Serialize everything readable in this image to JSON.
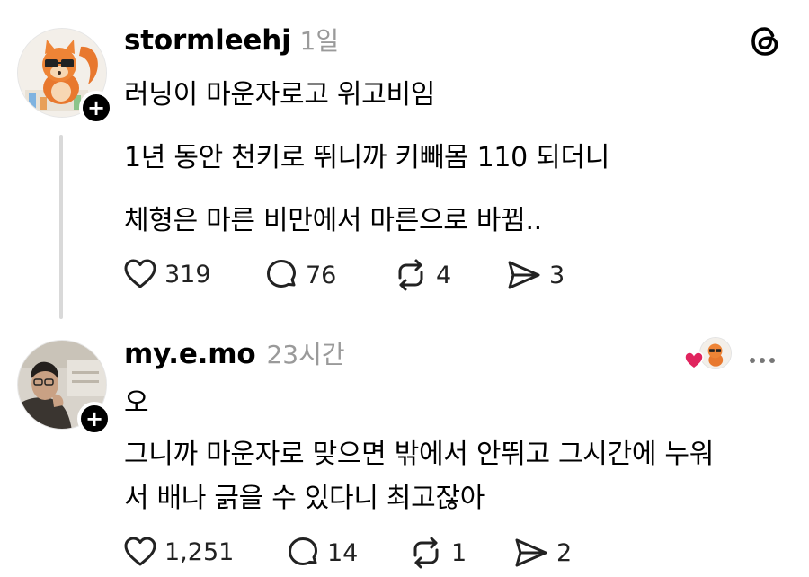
{
  "app": {
    "logo_icon": "threads-logo-icon"
  },
  "posts": [
    {
      "username": "stormleehj",
      "time": "1일",
      "lines": [
        "러닝이 마운자로고 위고비임",
        "1년 동안 천키로 뛰니까 키빼몸 110 되더니",
        "체형은 마른 비만에서 마른으로 바뀜.."
      ],
      "likes": "319",
      "comments": "76",
      "reposts": "4",
      "shares": "3"
    },
    {
      "username": "my.e.mo",
      "time": "23시간",
      "lines": [
        "오",
        "그니까 마운자로 맞으면 밖에서 안뛰고 그시간에 누워",
        "서 배나 긁을 수 있다니 최고잖아"
      ],
      "likes": "1,251",
      "comments": "14",
      "reposts": "1",
      "shares": "2"
    }
  ],
  "colors": {
    "heart_liked": "#e0245e",
    "muted": "#9a9a9a",
    "thread_line": "#d9d9d9"
  }
}
